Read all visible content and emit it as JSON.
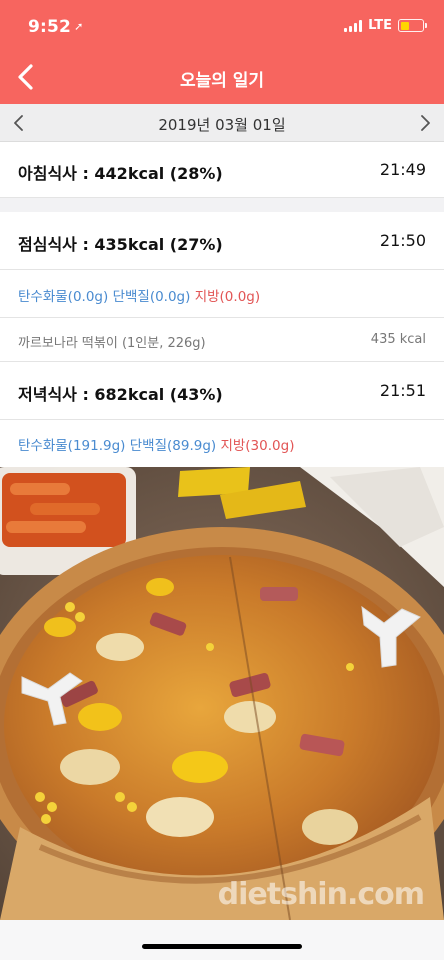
{
  "status_bar": {
    "time": "9:52",
    "location_glyph": "➚",
    "network": "LTE",
    "battery_color": "#ffd400"
  },
  "nav": {
    "title": "오늘의 일기",
    "back_icon": "chevron-left-icon"
  },
  "date_bar": {
    "date": "2019년 03월 01일",
    "prev_icon": "chevron-left-icon",
    "next_icon": "chevron-right-icon"
  },
  "breakfast": {
    "label": "아침식사 : 442kcal (28%)",
    "time": "21:49"
  },
  "lunch": {
    "label": "점심식사 : 435kcal (27%)",
    "time": "21:50",
    "carb": "탄수화물(0.0g)",
    "protein": "단백질(0.0g)",
    "fat": "지방(0.0g)",
    "food": {
      "name": "까르보나라 떡볶이 (1인분, 226g)",
      "kcal": "435 kcal"
    }
  },
  "dinner": {
    "label": "저녁식사 : 682kcal (43%)",
    "time": "21:51",
    "carb": "탄수화물(191.9g)",
    "protein": "단백질(89.9g)",
    "fat": "지방(30.0g)"
  },
  "photo": {
    "watermark": "dietshin.com"
  },
  "colors": {
    "accent": "#f7655f",
    "nutrient_blue": "#4a8bd0",
    "nutrient_red": "#e25555"
  }
}
